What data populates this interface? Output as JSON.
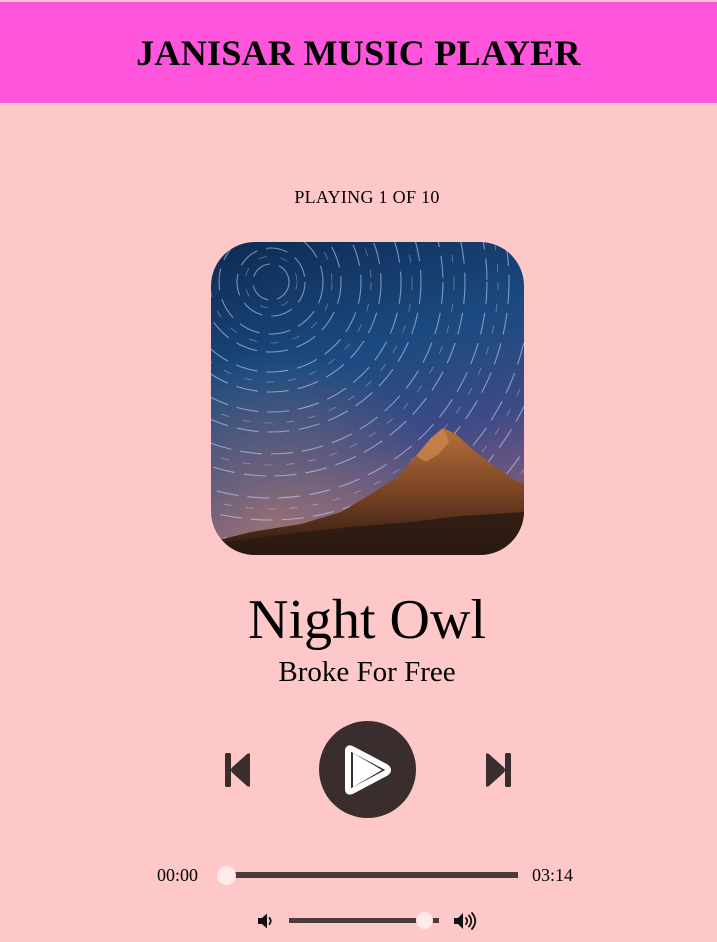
{
  "header": {
    "title": "JANISAR MUSIC PLAYER"
  },
  "player": {
    "now_playing": "PLAYING 1 OF 10",
    "track_title": "Night Owl",
    "track_artist": "Broke For Free",
    "current_time": "00:00",
    "total_time": "03:14",
    "seek_progress": 0,
    "volume_level": 0.9
  },
  "icons": {
    "prev": "skip-previous-icon",
    "play": "play-icon",
    "next": "skip-next-icon",
    "volume_down": "volume-down-icon",
    "volume_up": "volume-up-icon"
  },
  "colors": {
    "page_background": "#ffc8c8",
    "header_background": "#ff55dd",
    "control_dark": "#3a2d2d",
    "slider_track": "#4a3c3c",
    "slider_thumb": "#ffe9e9"
  }
}
